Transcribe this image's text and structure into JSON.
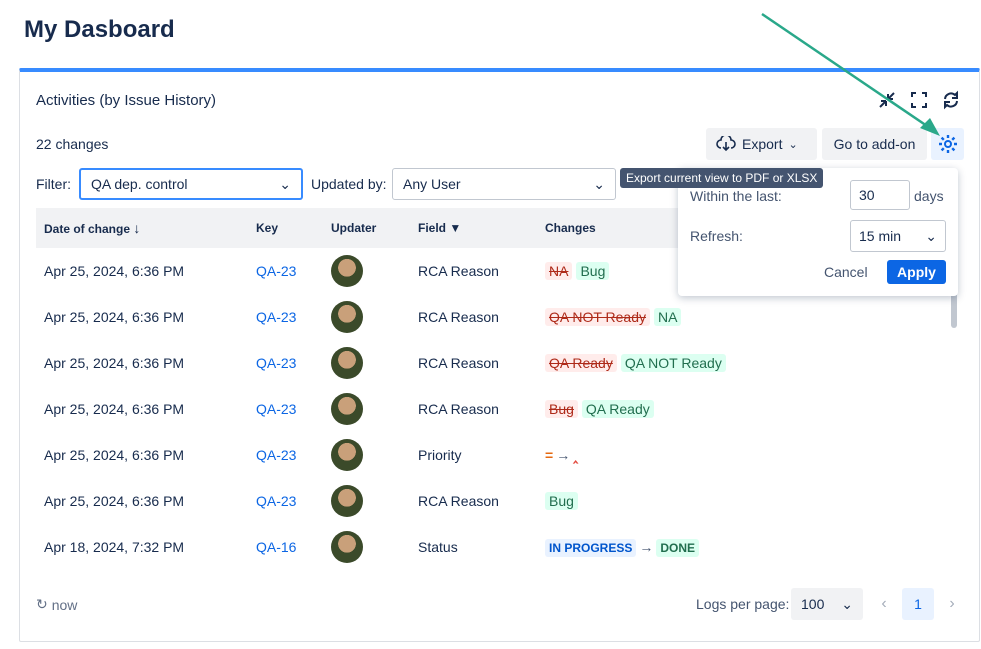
{
  "page": {
    "title": "My Dasboard"
  },
  "gadget": {
    "title": "Activities (by Issue History)",
    "changes_count": "22 changes",
    "export_label": "Export",
    "addon_label": "Go to add-on",
    "tooltip": "Export current view to PDF or XLSX"
  },
  "filters": {
    "filter_label": "Filter:",
    "filter_value": "QA dep. control",
    "updated_label": "Updated by:",
    "updated_value": "Any User"
  },
  "table": {
    "headers": [
      "Date of change",
      "Key",
      "Updater",
      "Field",
      "Changes"
    ],
    "rows": [
      {
        "date": "Apr 25, 2024, 6:36 PM",
        "key": "QA-23",
        "field": "RCA Reason",
        "old": "NA",
        "new": "Bug"
      },
      {
        "date": "Apr 25, 2024, 6:36 PM",
        "key": "QA-23",
        "field": "RCA Reason",
        "old": "QA NOT Ready",
        "new": "NA"
      },
      {
        "date": "Apr 25, 2024, 6:36 PM",
        "key": "QA-23",
        "field": "RCA Reason",
        "old": "QA Ready",
        "new": "QA NOT Ready"
      },
      {
        "date": "Apr 25, 2024, 6:36 PM",
        "key": "QA-23",
        "field": "RCA Reason",
        "old": "Bug",
        "new": "QA Ready"
      },
      {
        "date": "Apr 25, 2024, 6:36 PM",
        "key": "QA-23",
        "field": "Priority",
        "old": "",
        "new": ""
      },
      {
        "date": "Apr 25, 2024, 6:36 PM",
        "key": "QA-23",
        "field": "RCA Reason",
        "old": "",
        "new": "Bug"
      },
      {
        "date": "Apr 18, 2024, 7:32 PM",
        "key": "QA-16",
        "field": "Status",
        "old": "IN PROGRESS",
        "new": "DONE"
      }
    ]
  },
  "popup": {
    "within_label": "Within the last:",
    "within_value": "30",
    "days_label": "days",
    "refresh_label": "Refresh:",
    "refresh_value": "15 min",
    "cancel_label": "Cancel",
    "apply_label": "Apply"
  },
  "footer": {
    "refresh_text": "now",
    "logs_label": "Logs per page:",
    "logs_value": "100",
    "page": "1"
  },
  "colors": {
    "accent": "#0c66e4",
    "arrow": "#2aa88a"
  }
}
